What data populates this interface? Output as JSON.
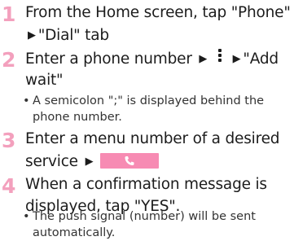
{
  "steps": [
    {
      "number": "1",
      "line1": "From the Home screen, tap \"Phone\"",
      "line2_arrow": "▶",
      "line2_text": "\"Dial\" tab"
    },
    {
      "number": "2",
      "line1_text": "Enter a phone number",
      "line1_arrow1": "▶",
      "line1_arrow2": "▶",
      "line1_end": "\"Add",
      "line2": "wait\"",
      "note_bullet": "•",
      "note_line1": "A semicolon \";\" is displayed behind the",
      "note_line2": "phone number."
    },
    {
      "number": "3",
      "line1": "Enter a menu number of a desired",
      "line2_text": "service",
      "line2_arrow": "▶"
    },
    {
      "number": "4",
      "line1": "When a confirmation message is",
      "line2": "displayed, tap \"YES\".",
      "note_bullet": "•",
      "note_line1": "The push signal (number) will be sent",
      "note_line2": "automatically."
    }
  ],
  "icons": {
    "menu_icon": "kebab-menu-icon",
    "call_icon": "phone-handset-icon",
    "call_button_color": "#f78bb3",
    "step_number_color": "#f3a0bd"
  }
}
